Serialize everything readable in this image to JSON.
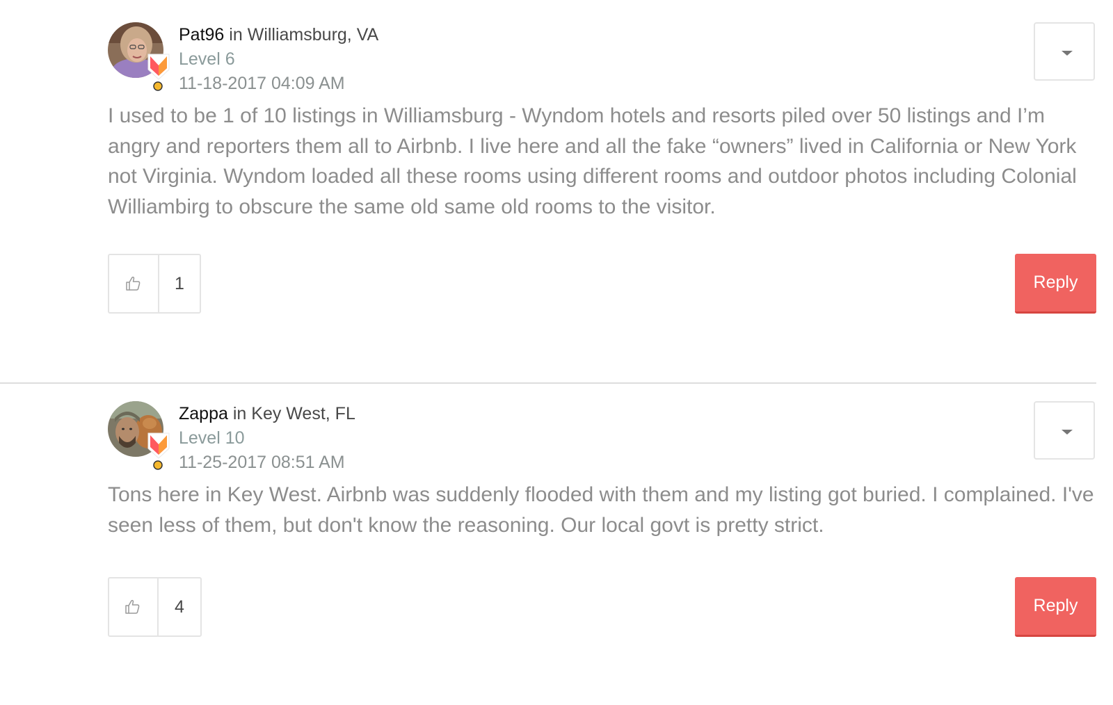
{
  "posts": [
    {
      "author": "Pat96",
      "in": "in",
      "location": "Williamsburg, VA",
      "level": "Level 6",
      "date": "11-18-2017 04:09 AM",
      "body": "I used to be 1 of 10 listings in Williamsburg - Wyndom hotels and resorts piled over 50 listings and I’m angry and reporters them all to Airbnb. I live here and all the fake “owners” lived in California or New York not Virginia. Wyndom loaded all these rooms using different rooms and outdoor photos including Colonial Williambirg to obscure the same old same old rooms to the visitor.",
      "kudos_count": "1",
      "reply_label": "Reply"
    },
    {
      "author": "Zappa",
      "in": "in",
      "location": "Key West, FL",
      "level": "Level 10",
      "date": "11-25-2017 08:51 AM",
      "body": "Tons here in Key West. Airbnb was suddenly flooded with them and my listing got buried. I complained. I've seen less of them, but don't know the reasoning. Our local govt is pretty strict.",
      "kudos_count": "4",
      "reply_label": "Reply"
    }
  ],
  "icons": {
    "kudos": "thumbs-up-icon",
    "options": "caret-down-icon",
    "rank": "rank-badge-icon",
    "medal": "medal-icon"
  },
  "colors": {
    "reply_button": "#f06360",
    "badge_red": "#ff5a5f",
    "badge_orange": "#fc9a3a",
    "medal": "#f5b82e"
  }
}
